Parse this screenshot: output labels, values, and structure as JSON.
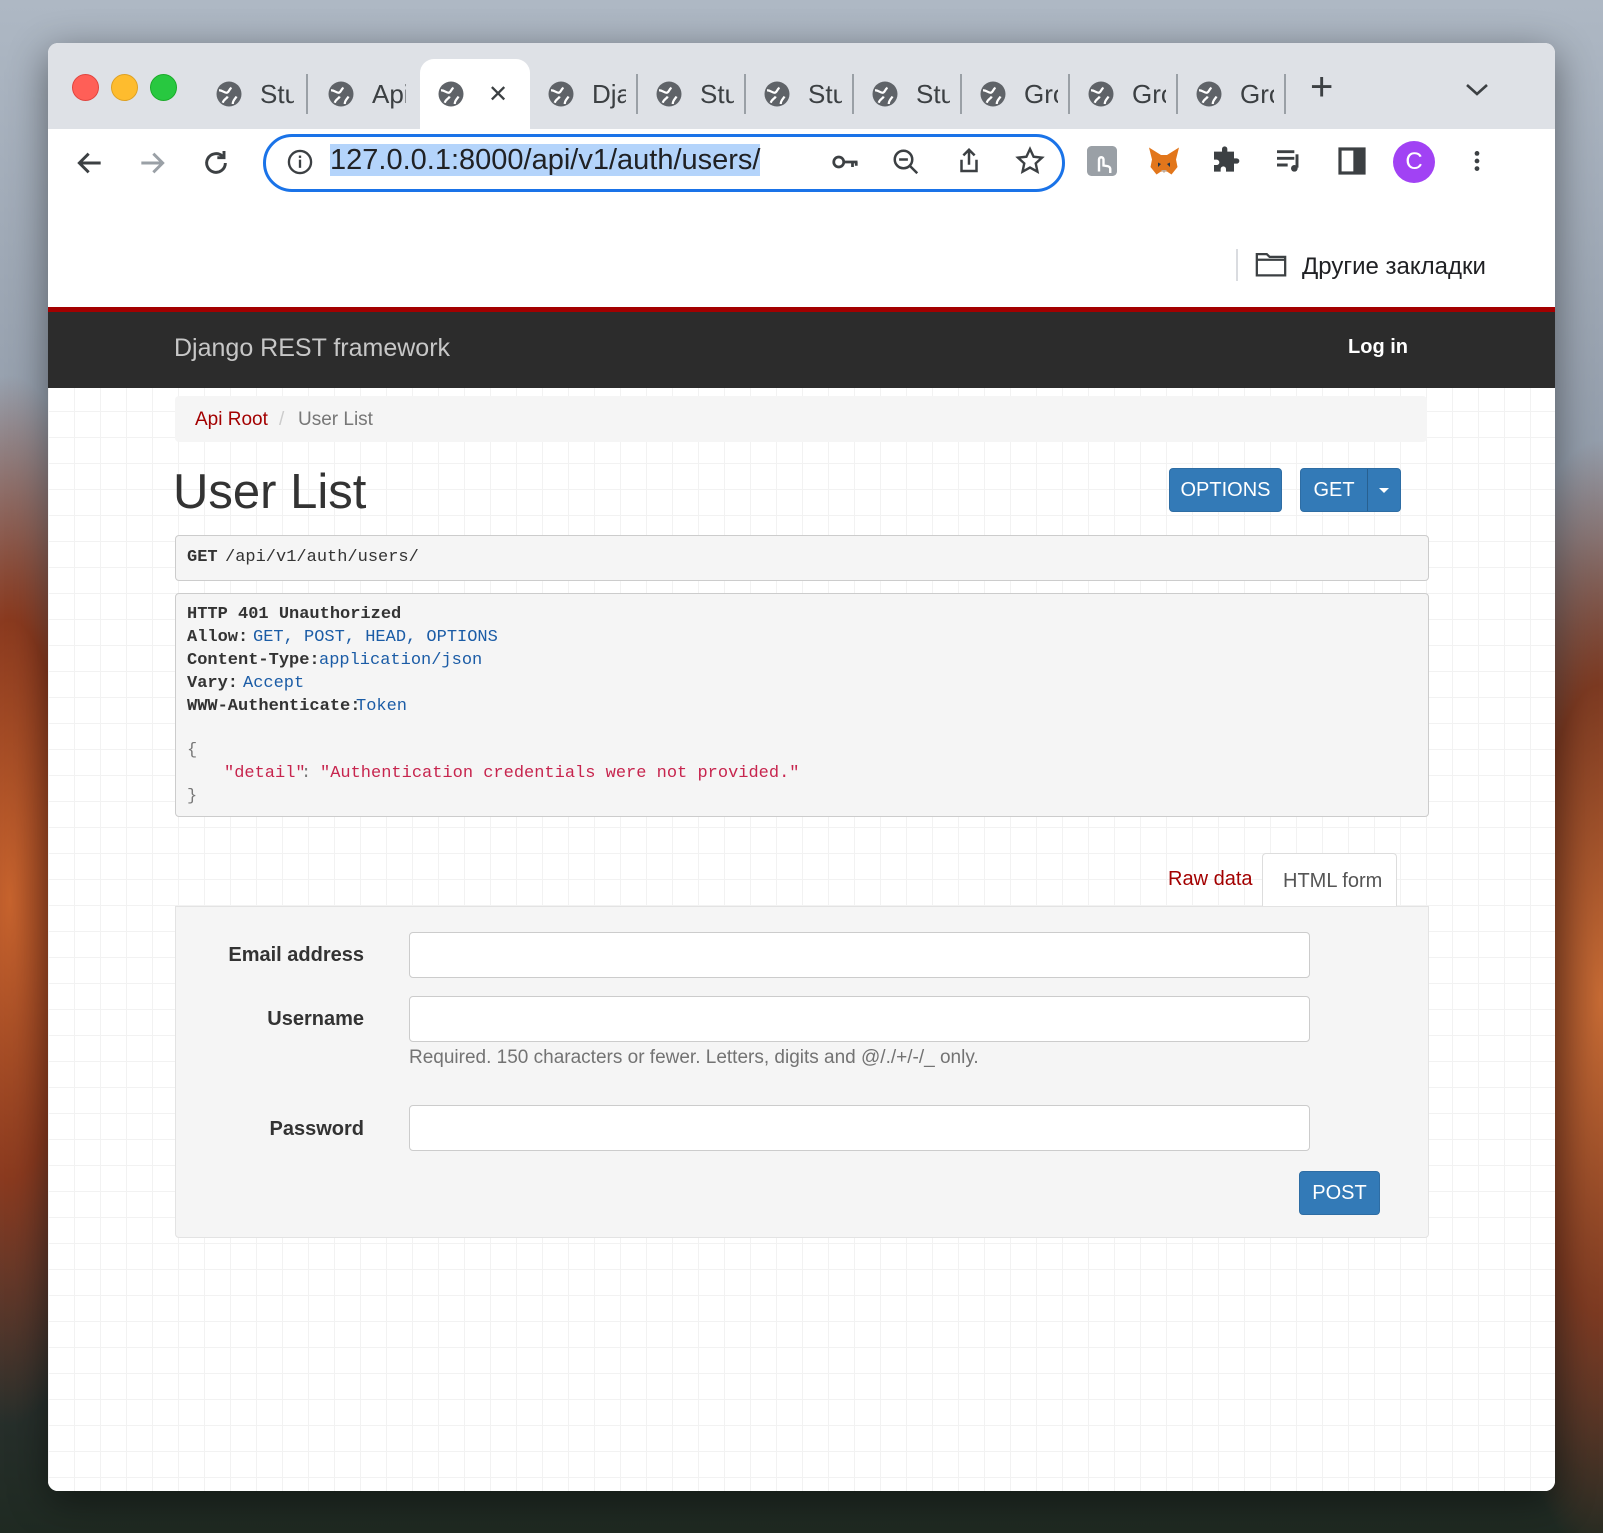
{
  "browser": {
    "tabs": [
      {
        "label": "Stu"
      },
      {
        "label": "Api"
      },
      {
        "label": ""
      },
      {
        "label": "Dja"
      },
      {
        "label": "Stu"
      },
      {
        "label": "Stu"
      },
      {
        "label": "Stu"
      },
      {
        "label": "Gro"
      },
      {
        "label": "Gro"
      },
      {
        "label": "Gro"
      }
    ],
    "active_tab_close": "✕",
    "new_tab": "+",
    "tab_search": "⌄",
    "url": "127.0.0.1:8000/api/v1/auth/users/",
    "profile_initial": "C",
    "bookmarks_folder": "Другие закладки"
  },
  "colors": {
    "navbar_bg": "#2c2c2c",
    "navbar_accent": "#a30000",
    "primary_button": "#337ab7",
    "link_red": "#a30000"
  },
  "app": {
    "brand": "Django REST framework",
    "login": "Log in",
    "breadcrumb": {
      "root": "Api Root",
      "separator": "/",
      "current": "User List"
    },
    "title": "User List",
    "buttons": {
      "options": "OPTIONS",
      "get": "GET",
      "post": "POST"
    },
    "request": {
      "method": "GET",
      "path": "/api/v1/auth/users/"
    },
    "response": {
      "status": "HTTP 401 Unauthorized",
      "headers": [
        {
          "name": "Allow:",
          "value": "GET, POST, HEAD, OPTIONS"
        },
        {
          "name": "Content-Type:",
          "value": "application/json"
        },
        {
          "name": "Vary:",
          "value": "Accept"
        },
        {
          "name": "WWW-Authenticate:",
          "value": "Token"
        }
      ],
      "open_brace": "{",
      "body_key": "\"detail\"",
      "body_colon": ": ",
      "body_value": "\"Authentication credentials were not provided.\"",
      "close_brace": "}"
    },
    "form_tabs": {
      "raw": "Raw data",
      "html": "HTML form"
    },
    "form": {
      "email_label": "Email address",
      "username_label": "Username",
      "username_help": "Required. 150 characters or fewer. Letters, digits and @/./+/-/_ only.",
      "password_label": "Password",
      "email_value": "",
      "username_value": "",
      "password_value": ""
    }
  }
}
